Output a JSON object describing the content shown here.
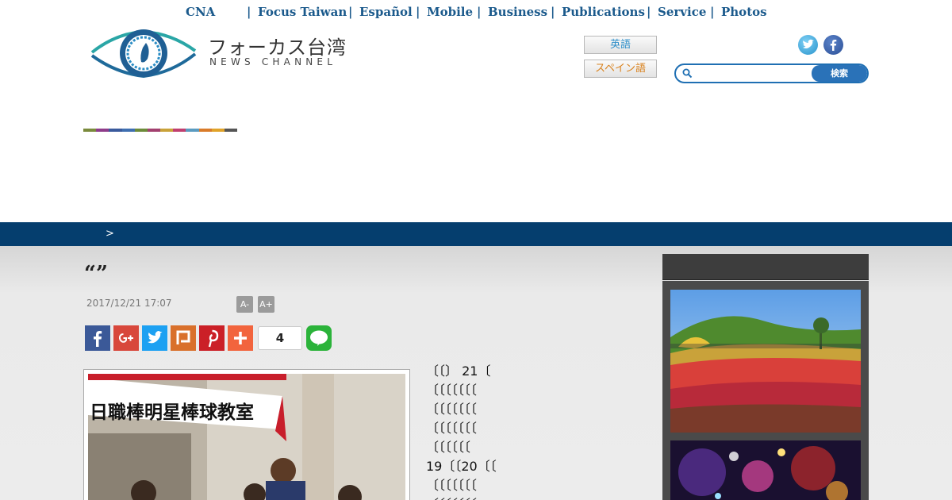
{
  "topnav": {
    "items": [
      "CNA",
      "Focus Taiwan",
      "Español",
      "Mobile",
      "Business",
      "Publications",
      "Service",
      "Photos"
    ],
    "separator": "|"
  },
  "header": {
    "logo_title": "フォーカス台湾",
    "logo_subtitle": "NEWS CHANNEL",
    "lang_en": "英語",
    "lang_es": "スペイン語",
    "search_placeholder": "",
    "search_button": "検索",
    "social_icons": [
      "twitter-icon",
      "facebook-icon"
    ],
    "strip_colors": [
      "#7a8a3c",
      "#8e3c8a",
      "#3a5a9c",
      "#3f6fb0",
      "#6c8b3a",
      "#a2416f",
      "#c9a23a",
      "#c03f6f",
      "#5b9bc0",
      "#d97b2a",
      "#e0a32a",
      "#555555"
    ]
  },
  "breadcrumb": {
    "separator": ">"
  },
  "article": {
    "headline": "“”",
    "date": "2017/12/21 17:07",
    "font_minus": "A-",
    "font_plus": "A+",
    "share_count": "4",
    "share_icons": [
      "facebook-icon",
      "google-plus-icon",
      "twitter-icon",
      "plurk-icon",
      "pinterest-icon",
      "more-plus-icon",
      "line-icon"
    ],
    "text_lines": [
      "〔〔〕 21〔",
      "〔〔〔〔〔〔〔",
      "〔〔〔〔〔〔〔",
      "〔〔〔〔〔〔〔",
      "〔〔〔〔〔〔",
      "19〔〔20〔〔",
      "〔〔〔〔〔〔〔",
      "〔〔〔〔〔〔〔"
    ],
    "photo_banner_text": "日職棒明星棒球教室"
  },
  "colors": {
    "nav_link": "#1b5a8c",
    "blue_bar": "#053e6e",
    "search_border": "#1f6fb3"
  }
}
